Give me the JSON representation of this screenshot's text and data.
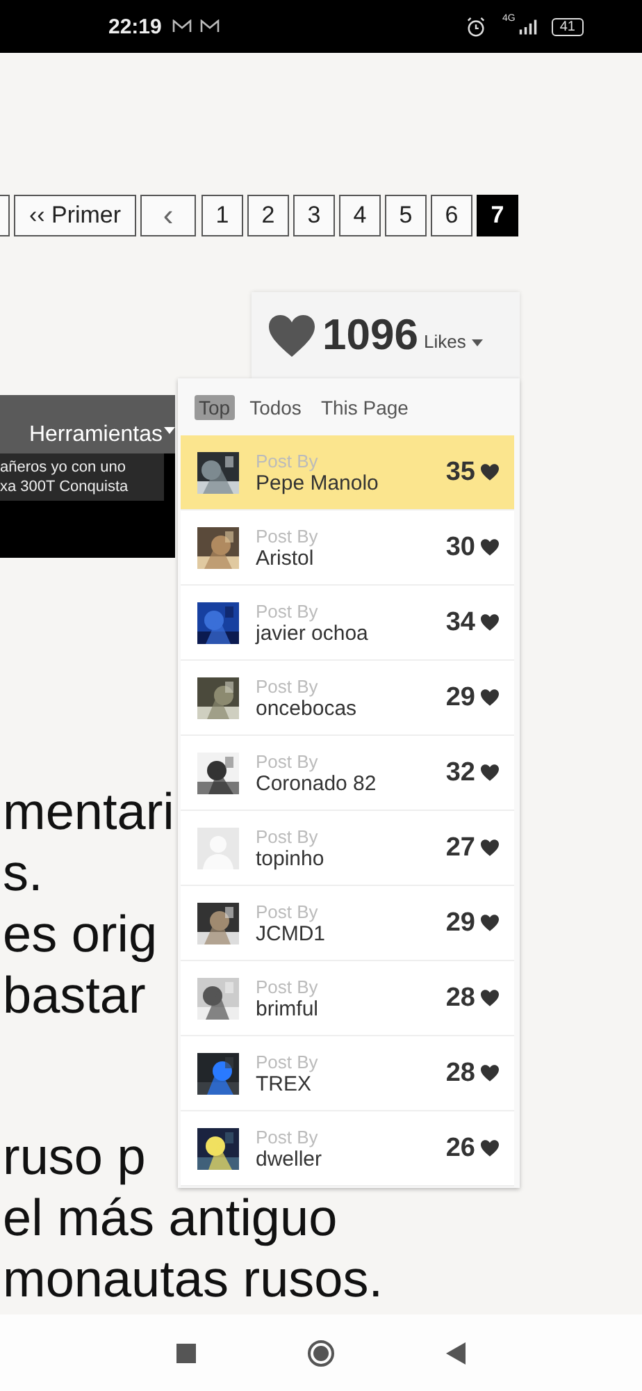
{
  "status_bar": {
    "time": "22:19",
    "network": "4G",
    "battery": "41"
  },
  "pagination": {
    "first": "‹‹ Primer",
    "prev": "‹",
    "pages": [
      {
        "label": "1",
        "selected": false
      },
      {
        "label": "2",
        "selected": false
      },
      {
        "label": "3",
        "selected": false
      },
      {
        "label": "4",
        "selected": false
      },
      {
        "label": "5",
        "selected": false
      },
      {
        "label": "6",
        "selected": false
      },
      {
        "label": "7",
        "selected": true
      }
    ]
  },
  "toolbar": {
    "label": "Herramientas",
    "tooltip_lines": [
      "añeros yo con uno",
      "xa 300T Conquista"
    ]
  },
  "article_paragraphs": [
    {
      "lines": [
        "mentari",
        "s.",
        "es orig",
        "bastar"
      ]
    },
    {
      "lines": [
        "ruso p",
        "el más antiguo",
        "monautas rusos."
      ]
    }
  ],
  "likes": {
    "count": "1096",
    "label": "Likes",
    "tabs": [
      {
        "label": "Top",
        "selected": true
      },
      {
        "label": "Todos",
        "selected": false
      },
      {
        "label": "This Page",
        "selected": false
      }
    ],
    "rows": [
      {
        "caption": "Post By",
        "author": "Pepe Manolo",
        "likes": "35",
        "highlighted": true,
        "kind": "picture"
      },
      {
        "caption": "Post By",
        "author": "Aristol",
        "likes": "30",
        "highlighted": false,
        "kind": "picture"
      },
      {
        "caption": "Post By",
        "author": "javier ochoa",
        "likes": "34",
        "highlighted": false,
        "kind": "picture"
      },
      {
        "caption": "Post By",
        "author": "oncebocas",
        "likes": "29",
        "highlighted": false,
        "kind": "picture"
      },
      {
        "caption": "Post By",
        "author": "Coronado 82",
        "likes": "32",
        "highlighted": false,
        "kind": "picture"
      },
      {
        "caption": "Post By",
        "author": "topinho",
        "likes": "27",
        "highlighted": false,
        "kind": "default_avatar"
      },
      {
        "caption": "Post By",
        "author": "JCMD1",
        "likes": "29",
        "highlighted": false,
        "kind": "picture"
      },
      {
        "caption": "Post By",
        "author": "brimful",
        "likes": "28",
        "highlighted": false,
        "kind": "picture"
      },
      {
        "caption": "Post By",
        "author": "TREX",
        "likes": "28",
        "highlighted": false,
        "kind": "picture"
      },
      {
        "caption": "Post By",
        "author": "dweller",
        "likes": "26",
        "highlighted": false,
        "kind": "picture"
      }
    ]
  }
}
